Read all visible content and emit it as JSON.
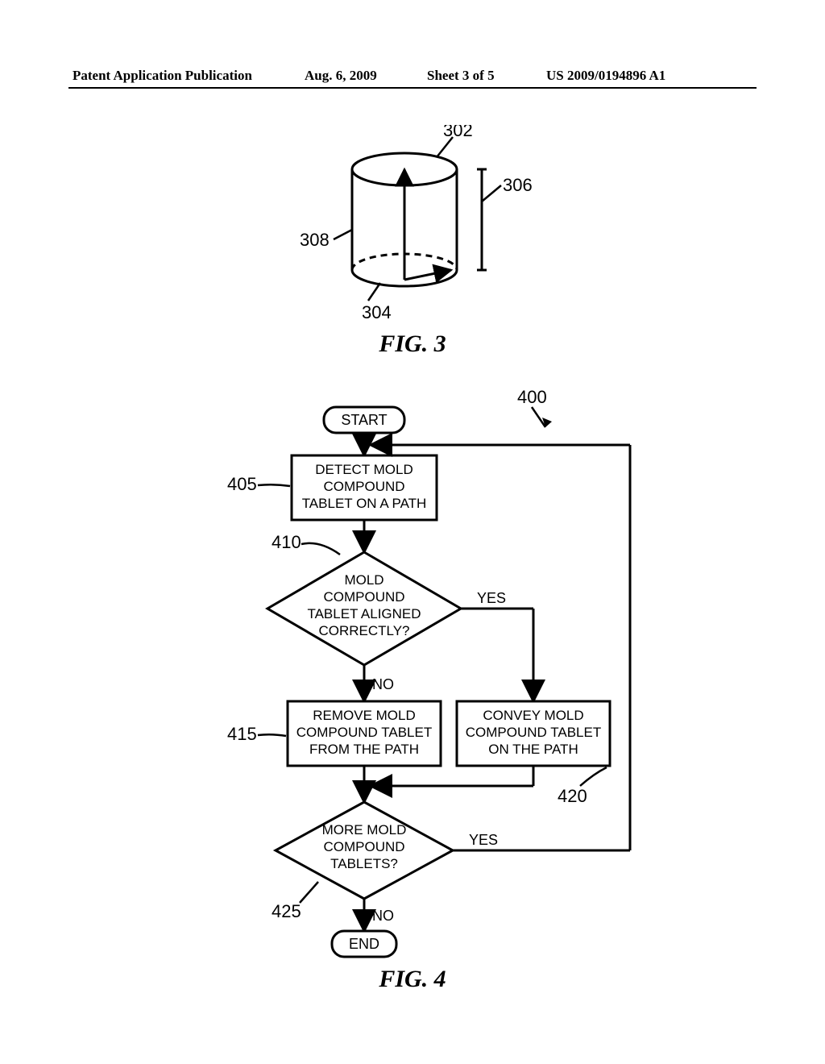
{
  "header": {
    "left": "Patent Application Publication",
    "date": "Aug. 6, 2009",
    "sheet": "Sheet 3 of 5",
    "pubno": "US 2009/0194896 A1"
  },
  "fig3": {
    "label": "FIG. 3",
    "ref302": "302",
    "ref304": "304",
    "ref306": "306",
    "ref308": "308"
  },
  "fig4": {
    "label": "FIG. 4",
    "ref400": "400",
    "ref405": "405",
    "ref410": "410",
    "ref415": "415",
    "ref420": "420",
    "ref425": "425",
    "start": "START",
    "end": "END",
    "step405l1": "DETECT MOLD",
    "step405l2": "COMPOUND",
    "step405l3": "TABLET ON A PATH",
    "dec410l1": "MOLD",
    "dec410l2": "COMPOUND",
    "dec410l3": "TABLET ALIGNED",
    "dec410l4": "CORRECTLY?",
    "yes": "YES",
    "no": "NO",
    "step415l1": "REMOVE MOLD",
    "step415l2": "COMPOUND TABLET",
    "step415l3": "FROM THE PATH",
    "step420l1": "CONVEY MOLD",
    "step420l2": "COMPOUND TABLET",
    "step420l3": "ON THE PATH",
    "dec425l1": "MORE MOLD",
    "dec425l2": "COMPOUND",
    "dec425l3": "TABLETS?"
  }
}
